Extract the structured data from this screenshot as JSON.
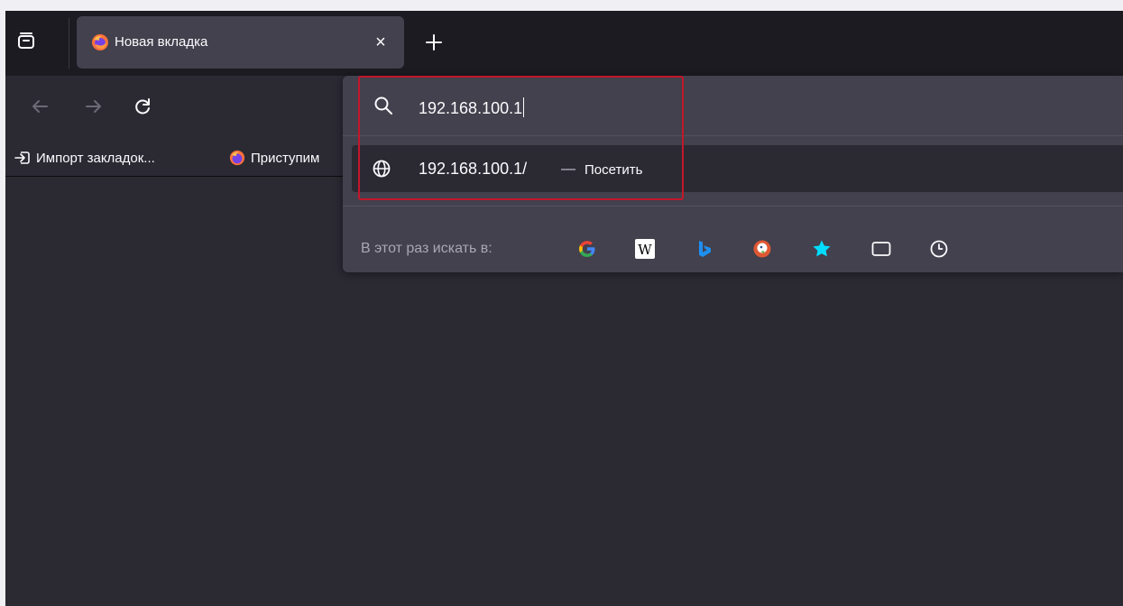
{
  "tab": {
    "title": "Новая вкладка",
    "close_glyph": "×",
    "favicon": "firefox-icon"
  },
  "toolbar": {
    "back_icon": "arrow-left-icon",
    "forward_icon": "arrow-right-icon",
    "reload_icon": "reload-icon"
  },
  "bookmarks": {
    "items": [
      {
        "label": "Импорт закладок...",
        "icon": "import-icon"
      },
      {
        "label": "Приступим",
        "icon": "firefox-icon"
      }
    ]
  },
  "urlbar": {
    "value": "192.168.100.1",
    "search_icon": "search-icon"
  },
  "suggestion": {
    "url": "192.168.100.1/",
    "separator": "—",
    "action": "Посетить",
    "icon": "globe-icon"
  },
  "engines": {
    "label": "В этот раз искать в:",
    "items": [
      "google-icon",
      "wikipedia-icon",
      "bing-icon",
      "duckduckgo-icon",
      "bookmarks-star-icon",
      "tabs-icon",
      "history-icon"
    ]
  },
  "colors": {
    "window_bg": "#2b2a33",
    "tabbar_bg": "#1c1b22",
    "popup_bg": "#42414d",
    "highlight": "#c4162a",
    "text": "#fbfbfe"
  }
}
